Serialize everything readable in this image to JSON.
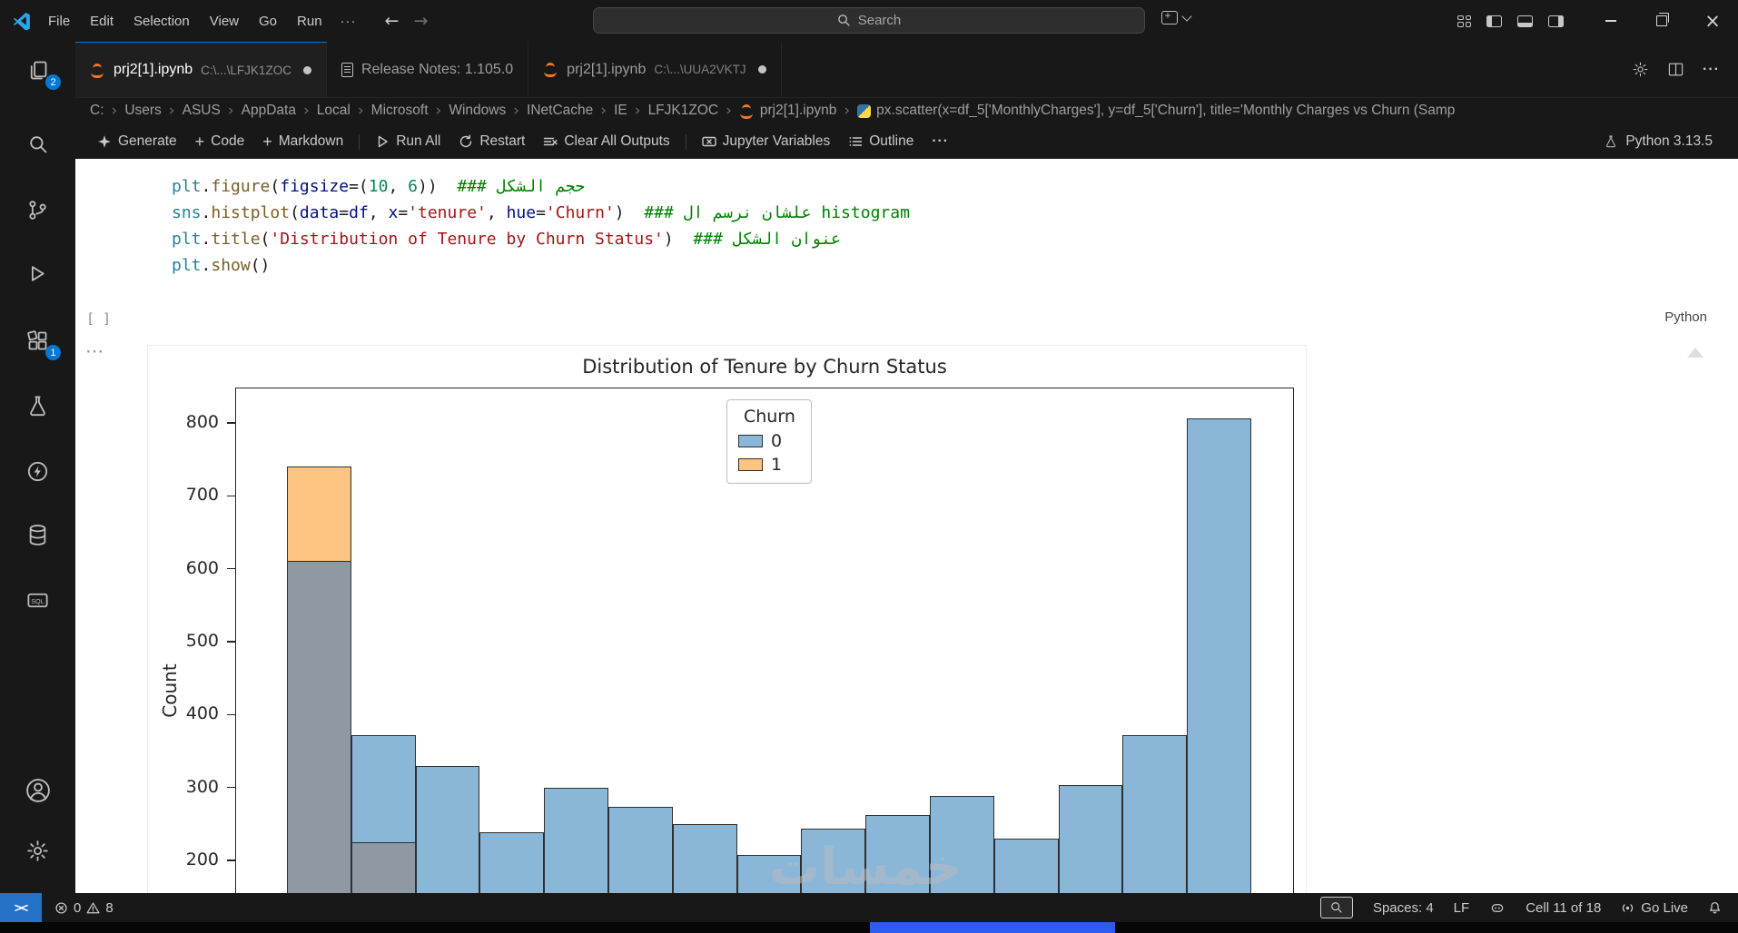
{
  "titlebar": {
    "menus": [
      "File",
      "Edit",
      "Selection",
      "View",
      "Go",
      "Run"
    ],
    "more": "···",
    "search_placeholder": "Search"
  },
  "activity_bar": {
    "explorer_badge": "2",
    "extensions_badge": "1"
  },
  "tabs": [
    {
      "label": "prj2[1].ipynb",
      "detail": "C:\\...\\LFJK1ZOC",
      "modified": true,
      "active": true
    },
    {
      "label": "Release Notes: 1.105.0",
      "detail": "",
      "modified": false,
      "active": false
    },
    {
      "label": "prj2[1].ipynb",
      "detail": "C:\\...\\UUA2VKTJ",
      "modified": true,
      "active": false
    }
  ],
  "breadcrumbs": {
    "path": [
      "C:",
      "Users",
      "ASUS",
      "AppData",
      "Local",
      "Microsoft",
      "Windows",
      "INetCache",
      "IE",
      "LFJK1ZOC"
    ],
    "file": "prj2[1].ipynb",
    "cell": "px.scatter(x=df_5['MonthlyCharges'], y=df_5['Churn'], title='Monthly Charges vs Churn (Samp"
  },
  "notebook_toolbar": {
    "generate": "Generate",
    "code": "Code",
    "markdown": "Markdown",
    "run_all": "Run All",
    "restart": "Restart",
    "clear_all": "Clear All Outputs",
    "jupyter_variables": "Jupyter Variables",
    "outline": "Outline",
    "more": "···",
    "kernel": "Python 3.13.5"
  },
  "cell": {
    "execution": "[ ]",
    "language": "Python",
    "gutter_more": "···",
    "code_lines": [
      {
        "tokens": [
          {
            "t": "plt",
            "c": "mod"
          },
          {
            "t": ".",
            "c": "pun"
          },
          {
            "t": "figure",
            "c": "fn"
          },
          {
            "t": "(",
            "c": "pun"
          },
          {
            "t": "figsize",
            "c": "param"
          },
          {
            "t": "=(",
            "c": "pun"
          },
          {
            "t": "10",
            "c": "num"
          },
          {
            "t": ", ",
            "c": "pun"
          },
          {
            "t": "6",
            "c": "num"
          },
          {
            "t": "))",
            "c": "pun"
          },
          {
            "t": "  ### حجم الشكل",
            "c": "com"
          }
        ]
      },
      {
        "tokens": [
          {
            "t": "sns",
            "c": "mod"
          },
          {
            "t": ".",
            "c": "pun"
          },
          {
            "t": "histplot",
            "c": "fn"
          },
          {
            "t": "(",
            "c": "pun"
          },
          {
            "t": "data",
            "c": "param"
          },
          {
            "t": "=",
            "c": "pun"
          },
          {
            "t": "df",
            "c": "var"
          },
          {
            "t": ", ",
            "c": "pun"
          },
          {
            "t": "x",
            "c": "param"
          },
          {
            "t": "=",
            "c": "pun"
          },
          {
            "t": "'tenure'",
            "c": "str"
          },
          {
            "t": ", ",
            "c": "pun"
          },
          {
            "t": "hue",
            "c": "param"
          },
          {
            "t": "=",
            "c": "pun"
          },
          {
            "t": "'Churn'",
            "c": "str"
          },
          {
            "t": ")",
            "c": "pun"
          },
          {
            "t": "  ### علشان نرسم ال histogram",
            "c": "com"
          }
        ]
      },
      {
        "tokens": [
          {
            "t": "plt",
            "c": "mod"
          },
          {
            "t": ".",
            "c": "pun"
          },
          {
            "t": "title",
            "c": "fn"
          },
          {
            "t": "(",
            "c": "pun"
          },
          {
            "t": "'Distribution of Tenure by Churn Status'",
            "c": "str"
          },
          {
            "t": ")",
            "c": "pun"
          },
          {
            "t": "  ### عنوان الشكل",
            "c": "com"
          }
        ]
      },
      {
        "tokens": [
          {
            "t": "plt",
            "c": "mod"
          },
          {
            "t": ".",
            "c": "pun"
          },
          {
            "t": "show",
            "c": "fn"
          },
          {
            "t": "()",
            "c": "pun"
          }
        ]
      }
    ]
  },
  "chart_data": {
    "type": "histogram",
    "title": "Distribution of Tenure by Churn Status",
    "xlabel": "",
    "ylabel": "Count",
    "yticks": [
      800,
      700,
      600,
      500,
      400,
      300,
      200
    ],
    "bins": 15,
    "legend": {
      "title": "Churn",
      "entries": [
        {
          "label": "0",
          "color": "#8ab6d8"
        },
        {
          "label": "1",
          "color": "#fdc381"
        }
      ]
    },
    "overlap_color": "#8e99a3",
    "edge_color": "#2f2f2f",
    "series": [
      {
        "name": "0",
        "color": "#8ab6d8",
        "values": [
          612,
          372,
          330,
          238,
          300,
          273,
          250,
          207,
          243,
          262,
          288,
          230,
          303,
          372,
          806
        ]
      },
      {
        "name": "1",
        "color": "#fdc381",
        "values": [
          740,
          226,
          null,
          null,
          null,
          null,
          null,
          null,
          null,
          null,
          null,
          null,
          null,
          null,
          null
        ]
      }
    ]
  },
  "watermark": "خمسات",
  "status_bar": {
    "errors": "0",
    "warnings": "8",
    "spaces": "Spaces: 4",
    "eol": "LF",
    "cell_position": "Cell 11 of 18",
    "go_live": "Go Live"
  }
}
